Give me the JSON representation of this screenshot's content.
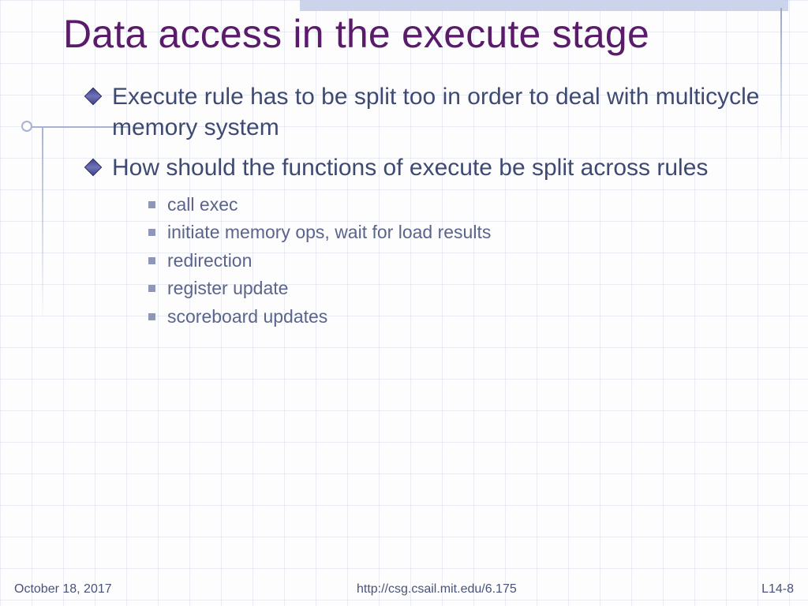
{
  "title": "Data access in the execute stage",
  "bullets": {
    "b0": "Execute rule has to be split too in order to deal with multicycle memory system",
    "b1": "How should the functions of execute be split across rules",
    "sub": {
      "s0": "call exec",
      "s1": "initiate memory ops, wait for load results",
      "s2": "redirection",
      "s3": "register update",
      "s4": "scoreboard updates"
    }
  },
  "footer": {
    "date": "October 18, 2017",
    "center": "http://csg.csail.mit.edu/6.175",
    "right": "L14-8"
  }
}
